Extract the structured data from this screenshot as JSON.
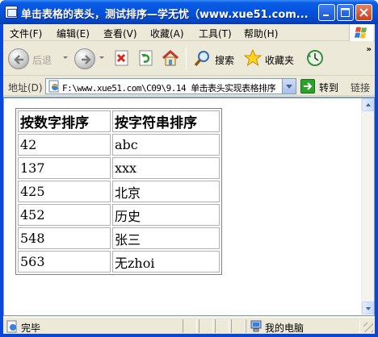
{
  "window": {
    "title": "单击表格的表头，测试排序—学无忧（www.xue51.com...",
    "controls": [
      "minimize",
      "maximize",
      "close"
    ]
  },
  "menu": {
    "items": [
      {
        "label": "文件(F)"
      },
      {
        "label": "编辑(E)"
      },
      {
        "label": "查看(V)"
      },
      {
        "label": "收藏(A)"
      },
      {
        "label": "工具(T)"
      },
      {
        "label": "帮助(H)"
      }
    ]
  },
  "toolbar": {
    "back_label": "后退",
    "search_label": "搜索",
    "favorites_label": "收藏夹",
    "more": "»"
  },
  "address": {
    "label": "地址(D)",
    "value": "F:\\www.xue51.com\\C09\\9.14 单击表头实现表格排序",
    "go_label": "转到",
    "links_label": "链接"
  },
  "table": {
    "headers": [
      "按数字排序",
      "按字符串排序"
    ],
    "rows": [
      [
        "42",
        "abc"
      ],
      [
        "137",
        "xxx"
      ],
      [
        "425",
        "北京"
      ],
      [
        "452",
        "历史"
      ],
      [
        "548",
        "张三"
      ],
      [
        "563",
        "无zhoi"
      ]
    ]
  },
  "status": {
    "text": "完毕",
    "zone": "我的电脑"
  },
  "colors": {
    "titlebar": "#0553dc",
    "chrome": "#ece9d8",
    "close_button": "#c6401f"
  }
}
